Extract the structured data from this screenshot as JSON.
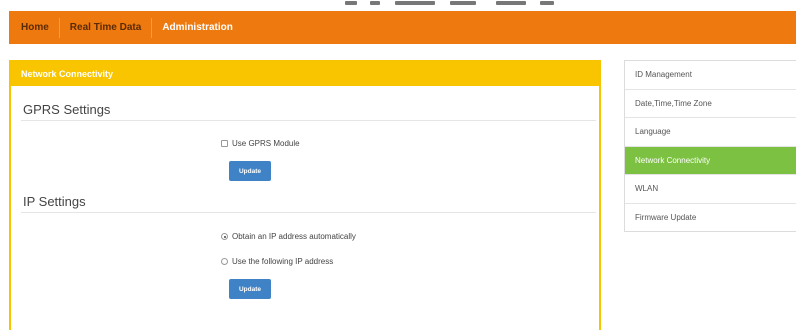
{
  "nav": {
    "items": [
      {
        "label": "Home"
      },
      {
        "label": "Real Time Data"
      },
      {
        "label": "Administration"
      }
    ],
    "active_index": 2
  },
  "panel": {
    "heading": "Network Connectivity",
    "gprs": {
      "title": "GPRS Settings",
      "checkbox_label": "Use GPRS Module",
      "checked": false,
      "button_label": "Update"
    },
    "ip": {
      "title": "IP Settings",
      "radio_auto_label": "Obtain an IP address automatically",
      "radio_manual_label": "Use the following IP address",
      "selected": "auto",
      "button_label": "Update"
    }
  },
  "sidemenu": {
    "items": [
      {
        "label": "ID Management"
      },
      {
        "label": "Date,Time,Time Zone"
      },
      {
        "label": "Language"
      },
      {
        "label": "Network Connectivity"
      },
      {
        "label": "WLAN"
      },
      {
        "label": "Firmware Update"
      }
    ],
    "active_index": 3
  },
  "colors": {
    "topbar": "#ee7a0f",
    "panel_heading": "#f9c500",
    "active_menu": "#7cc142",
    "button": "#3f83c6"
  }
}
